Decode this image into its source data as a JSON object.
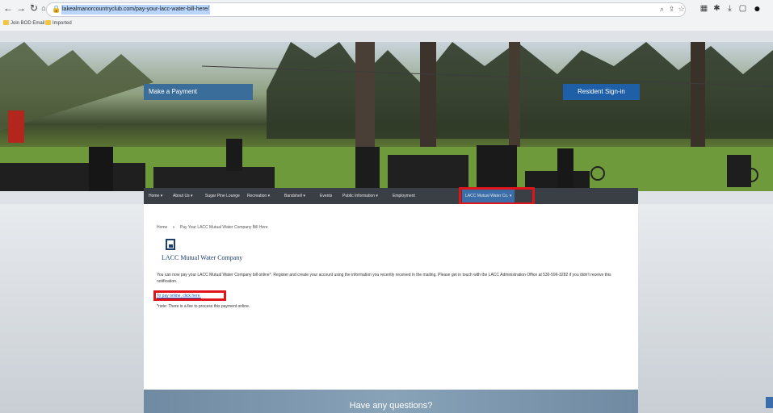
{
  "browser": {
    "url": "lakealmanorcountryclub.com/pay-your-lacc-water-bill-here/",
    "bookmarks": [
      "Join BOD Email",
      "Imported"
    ]
  },
  "hero": {
    "make_payment": "Make a Payment",
    "resident_signin": "Resident Sign-in"
  },
  "nav": {
    "items": [
      "Home ▾",
      "About Us ▾",
      "Sugar Pine Lounge",
      "Recreation ▾",
      "Bandshell ▾",
      "Events",
      "Public Information ▾",
      "Employment",
      "LACC Mutual Water Co. ▾"
    ]
  },
  "content": {
    "breadcrumb_home": "Home",
    "breadcrumb_sep": "»",
    "breadcrumb_current": "Pay Your LACC Mutual Water Company Bill Here",
    "company_name": "LACC Mutual Water Company",
    "paragraph": "You can now pay your LACC Mutual Water Company bill online*.  Register and create your account using the information you recently received in the mailing.  Please get in touch with the LACC Administration Office at 530-596-3282 if you didn't receive this notification.",
    "pay_link": "To pay online, click here.",
    "fee_note": "*note:  There is a fee to process this payment online."
  },
  "footer": {
    "question": "Have any questions?"
  },
  "colors": {
    "nav_bg": "#3a3f46",
    "nav_active": "#3b6ea8",
    "highlight": "#e0141b",
    "company_blue": "#1c3d6e",
    "link": "#1a55c4"
  }
}
